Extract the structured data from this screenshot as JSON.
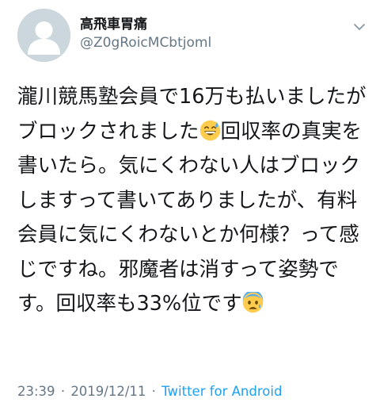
{
  "tweet": {
    "display_name": "高飛車胃痛",
    "handle": "@Z0gRoicMCbtjoml",
    "text_part1": "瀧川競馬塾会員で16万も払いましたがブロックされました",
    "emoji1": "grinning-face-with-sweat",
    "text_part2": "回収率の真実を書いたら。気にくわない人はブロックしますって書いてありましたが、有料会員に気にくわないとか何様？って感じですね。邪魔者は消すって姿勢です。回収率も33%位です",
    "emoji2": "anxious-face-with-sweat",
    "time": "23:39",
    "date": "2019/12/11",
    "separator": "·",
    "source": "Twitter for Android"
  },
  "colors": {
    "text": "#14171a",
    "secondary": "#657786",
    "link": "#1da1f2",
    "avatar_bg": "#ccd6dd",
    "avatar_fg": "#ffffff"
  },
  "icons": {
    "avatar": "default-profile-silhouette",
    "caret": "chevron-down-icon"
  }
}
